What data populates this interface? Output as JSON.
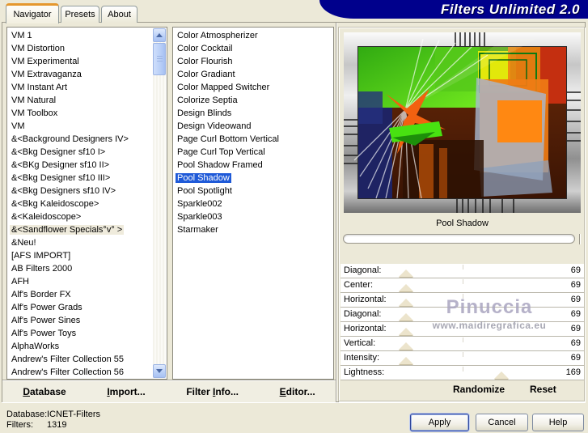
{
  "window": {
    "title": "Filters Unlimited 2.0"
  },
  "tabs": [
    {
      "label": "Navigator",
      "active": true
    },
    {
      "label": "Presets",
      "active": false
    },
    {
      "label": "About",
      "active": false
    }
  ],
  "left_list": {
    "selected_index": 15,
    "items": [
      "VM 1",
      "VM Distortion",
      "VM Experimental",
      "VM Extravaganza",
      "VM Instant Art",
      "VM Natural",
      "VM Toolbox",
      "VM",
      "&<Background Designers IV>",
      "&<Bkg Designer sf10 I>",
      "&<BKg Designer sf10 II>",
      "&<Bkg Designer sf10 III>",
      "&<Bkg Designers sf10 IV>",
      "&<Bkg Kaleidoscope>",
      "&<Kaleidoscope>",
      "&<Sandflower Specials°v° >",
      "&Neu!",
      "[AFS IMPORT]",
      "AB Filters 2000",
      "AFH",
      "Alf's Border FX",
      "Alf's Power Grads",
      "Alf's Power Sines",
      "Alf's Power Toys",
      "AlphaWorks",
      "Andrew's Filter Collection 55",
      "Andrew's Filter Collection 56"
    ]
  },
  "middle_list": {
    "selected_index": 11,
    "items": [
      "Color Atmospherizer",
      "Color Cocktail",
      "Color Flourish",
      "Color Gradiant",
      "Color Mapped Switcher",
      "Colorize Septia",
      "Design Blinds",
      "Design Videowand",
      "Page Curl Bottom Vertical",
      "Page Curl Top Vertical",
      "Pool Shadow Framed",
      "Pool Shadow",
      "Pool Spotlight",
      "Sparkle002",
      "Sparkle003",
      "Starmaker"
    ]
  },
  "preview": {
    "caption": "Pool Shadow"
  },
  "sliders": {
    "max": 255,
    "rows": [
      {
        "label": "Diagonal:",
        "value": 69
      },
      {
        "label": "Center:",
        "value": 69
      },
      {
        "label": "Horizontal:",
        "value": 69
      },
      {
        "label": "Diagonal:",
        "value": 69
      },
      {
        "label": "Horizontal:",
        "value": 69
      },
      {
        "label": "Vertical:",
        "value": 69
      },
      {
        "label": "Intensity:",
        "value": 69
      },
      {
        "label": "Lightness:",
        "value": 169
      }
    ]
  },
  "watermark": {
    "name": "Pinuccia",
    "url": "www.maidiregrafica.eu"
  },
  "panel_actions": {
    "randomize": "Randomize",
    "reset": "Reset"
  },
  "library_buttons": [
    {
      "pre": "",
      "key": "D",
      "post": "atabase"
    },
    {
      "pre": "",
      "key": "I",
      "post": "mport..."
    },
    {
      "pre": "Filter ",
      "key": "I",
      "post": "nfo..."
    },
    {
      "pre": "",
      "key": "E",
      "post": "ditor..."
    }
  ],
  "status": [
    {
      "label": "Database:",
      "value": "ICNET-Filters"
    },
    {
      "label": "Filters:",
      "value": "1319"
    }
  ],
  "dialog_buttons": [
    {
      "label": "Apply"
    },
    {
      "label": "Cancel"
    },
    {
      "label": "Help"
    }
  ],
  "colors": {
    "banner": "#00008C",
    "selection_active": "#1F5AD8",
    "selection_inactive": "#EFEBDC",
    "dialog_background": "#ECE9D8",
    "tab_accent": "#E5972D"
  }
}
